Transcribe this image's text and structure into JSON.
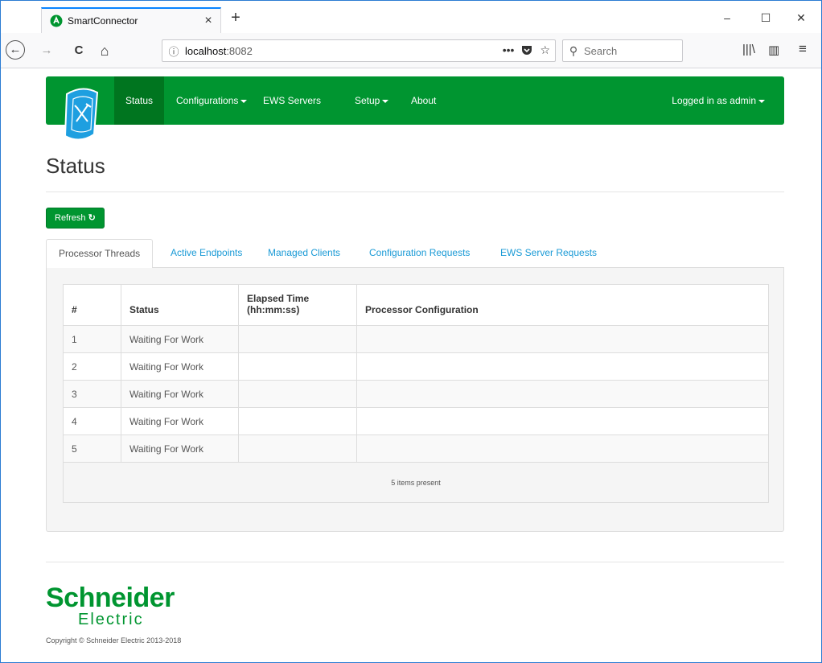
{
  "browser": {
    "tab_title": "SmartConnector",
    "tab_close": "×",
    "new_tab": "+",
    "minimize": "–",
    "maximize": "☐",
    "close": "✕",
    "back": "←",
    "forward": "→",
    "reload": "C",
    "home": "⌂",
    "url_host": "localhost",
    "url_port": ":8082",
    "page_actions": "•••",
    "search_placeholder": "Search",
    "library": "|||\\",
    "sidebar": "▥",
    "menu": "≡"
  },
  "appnav": {
    "items": [
      {
        "label": "Status",
        "active": true,
        "dropdown": false
      },
      {
        "label": "Configurations",
        "active": false,
        "dropdown": true
      },
      {
        "label": "EWS Servers",
        "active": false,
        "dropdown": false
      },
      {
        "label": "Setup",
        "active": false,
        "dropdown": true
      },
      {
        "label": "About",
        "active": false,
        "dropdown": false
      }
    ],
    "user": "Logged in as admin"
  },
  "page": {
    "title": "Status",
    "refresh_label": "Refresh",
    "tabs": [
      {
        "label": "Processor Threads",
        "active": true
      },
      {
        "label": "Active Endpoints",
        "active": false
      },
      {
        "label": "Managed Clients",
        "active": false
      },
      {
        "label": "Configuration Requests",
        "active": false
      },
      {
        "label": "EWS Server Requests",
        "active": false
      }
    ],
    "table": {
      "headers": [
        "#",
        "Status",
        "Elapsed Time\n(hh:mm:ss)",
        "Processor Configuration"
      ],
      "header_line1": "Elapsed Time",
      "header_line2": "(hh:mm:ss)",
      "rows": [
        [
          "1",
          "Waiting For Work",
          "",
          ""
        ],
        [
          "2",
          "Waiting For Work",
          "",
          ""
        ],
        [
          "3",
          "Waiting For Work",
          "",
          ""
        ],
        [
          "4",
          "Waiting For Work",
          "",
          ""
        ],
        [
          "5",
          "Waiting For Work",
          "",
          ""
        ]
      ],
      "footer": "5 items present"
    }
  },
  "footer": {
    "logo_line1": "Schneider",
    "logo_line2": "Electric",
    "copyright": "Copyright © Schneider Electric 2013-2018"
  },
  "colors": {
    "brand_green": "#009530",
    "active_green": "#00751f",
    "link_blue": "#1a9ad6"
  }
}
